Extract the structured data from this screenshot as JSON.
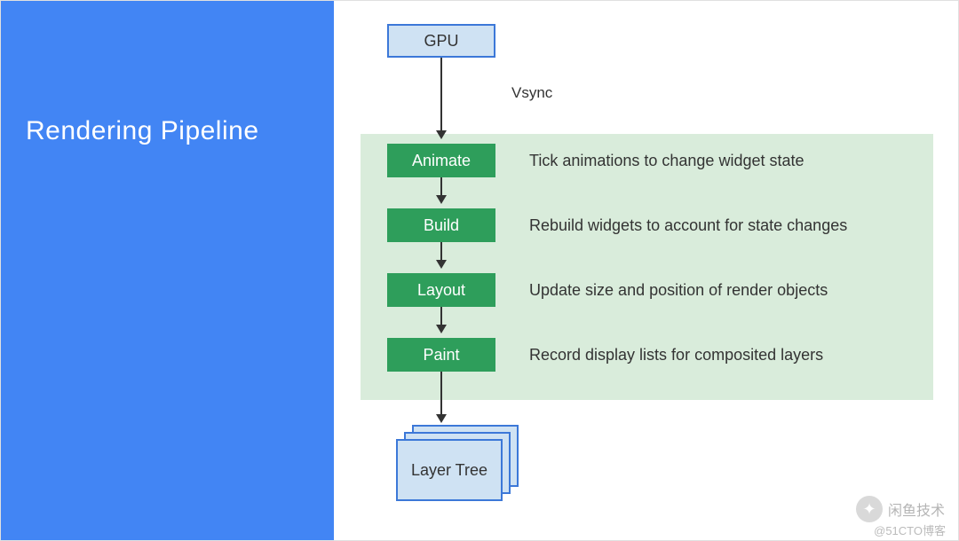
{
  "title": "Rendering Pipeline",
  "nodes": {
    "gpu": "GPU",
    "animate": "Animate",
    "build": "Build",
    "layout": "Layout",
    "paint": "Paint"
  },
  "vsync": "Vsync",
  "descriptions": {
    "animate": "Tick animations to change widget state",
    "build": "Rebuild widgets to account for state changes",
    "layout": "Update size and position of render objects",
    "paint": "Record display lists for composited layers"
  },
  "output": "Layer Tree",
  "watermark": {
    "brand": "闲鱼技术",
    "source": "@51CTO博客"
  }
}
